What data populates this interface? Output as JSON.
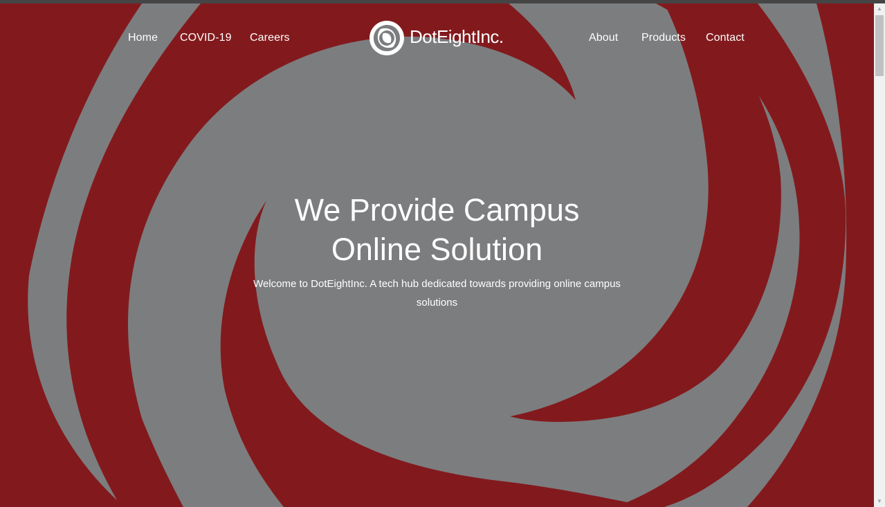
{
  "brand": {
    "name": "DotEightInc.",
    "logo_icon": "swirl-icon"
  },
  "nav": {
    "left": [
      "Home",
      "COVID-19",
      "Careers"
    ],
    "right": [
      "About",
      "Products",
      "Contact"
    ]
  },
  "hero": {
    "title_line1": "We Provide Campus",
    "title_line2": "Online Solution",
    "subtitle_line1": "Welcome to DotEightInc. A tech hub dedicated towards providing online campus",
    "subtitle_line2": "solutions"
  },
  "colors": {
    "crimson": "#821a1d",
    "gray": "#7c7d7f",
    "text": "#ffffff"
  },
  "scrollbar": {
    "up_icon": "scroll-up-arrow-icon",
    "down_icon": "scroll-down-arrow-icon"
  }
}
